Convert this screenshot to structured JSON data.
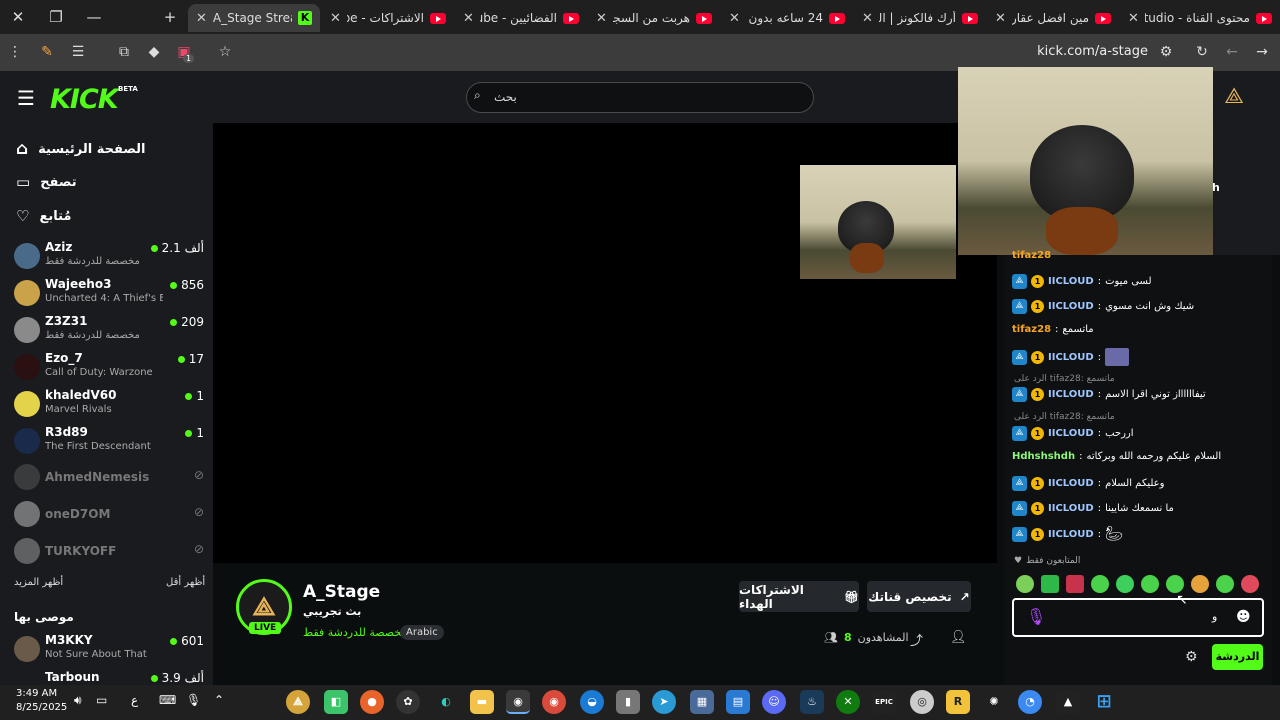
{
  "browser": {
    "tabs": [
      {
        "title": "A_Stage Stream",
        "icon": "kick"
      },
      {
        "title": "الاشتراكات - YouTube",
        "icon": "youtube"
      },
      {
        "title": "الفضائيين - YouTube",
        "icon": "youtube"
      },
      {
        "title": "هربت من السجن",
        "icon": "youtube"
      },
      {
        "title": "24 ساعه بدون جو",
        "icon": "youtube"
      },
      {
        "title": "أرك فالكونز | البدا",
        "icon": "youtube"
      },
      {
        "title": "مين افضل عقاري",
        "icon": "youtube"
      },
      {
        "title": "محتوى القناة - YouTube Studio",
        "icon": "youtube"
      }
    ],
    "new_tab": "+",
    "url": "kick.com/a-stage",
    "extension_badge": "1"
  },
  "header": {
    "logo": "KICK",
    "logo_badge": "BETA",
    "search_placeholder": "بحث"
  },
  "sidebar": {
    "nav": [
      {
        "label": "الصفحة الرئيسية",
        "icon": "home-icon"
      },
      {
        "label": "تصفح",
        "icon": "browse-icon"
      },
      {
        "label": "مُتابع",
        "icon": "heart-icon"
      }
    ],
    "following": [
      {
        "name": "Aziz",
        "sub": "مخصصة للدردشة فقط",
        "count": "2.1 ألف",
        "live": true
      },
      {
        "name": "Wajeeho3",
        "sub": "Uncharted 4: A Thief's End",
        "count": "856",
        "live": true
      },
      {
        "name": "Z3Z31",
        "sub": "مخصصة للدردشة فقط",
        "count": "209",
        "live": true
      },
      {
        "name": "Ezo_7",
        "sub": "Call of Duty: Warzone",
        "count": "17",
        "live": true
      },
      {
        "name": "khaledV60",
        "sub": "Marvel Rivals",
        "count": "1",
        "live": true
      },
      {
        "name": "R3d89",
        "sub": "The First Descendant",
        "count": "1",
        "live": true
      },
      {
        "name": "AhmedNemesis",
        "sub": "",
        "count": "",
        "live": false
      },
      {
        "name": "oneD7OM",
        "sub": "",
        "count": "",
        "live": false
      },
      {
        "name": "TURKYOFF",
        "sub": "",
        "count": "",
        "live": false
      }
    ],
    "show_less": "أظهر أقل",
    "show_more": "أظهر المزيد",
    "recommended_title": "موصى بها",
    "recommended": [
      {
        "name": "M3KKY",
        "sub": "Not Sure About That",
        "count": "601",
        "live": true
      },
      {
        "name": "Tarboun",
        "sub": "",
        "count": "3.9 ألف",
        "live": true
      }
    ]
  },
  "channel": {
    "name": "A_Stage",
    "title": "بث تجريبي",
    "category": "مخصصة للدردشة فقط",
    "language": "Arabic",
    "live_badge": "LIVE",
    "gift_button": "الاشتراكات الهداء",
    "customize_button": "تخصيص قناتك",
    "viewers_label": "المشاهدون",
    "viewers": "8"
  },
  "chat": {
    "partial_title": "h",
    "messages": [
      {
        "user": "tifaz28",
        "text": "",
        "badges": false,
        "color": "orange",
        "partial": true
      },
      {
        "user": "IICLOUD",
        "text": "لسى ميوت",
        "badges": true,
        "color": "blue"
      },
      {
        "user": "IICLOUD",
        "text": "شيك وش انت مسوي",
        "badges": true,
        "color": "blue"
      },
      {
        "user": "tifaz28",
        "text": "ماتسمع",
        "badges": false,
        "color": "orange"
      },
      {
        "user": "IICLOUD",
        "text": "",
        "badges": true,
        "color": "blue",
        "emote": true
      },
      {
        "user": "IICLOUD",
        "text": "تيفااااااز توني اقرا الاسم",
        "badges": true,
        "color": "blue",
        "reply": "الرد على tifaz28: ماتسمع"
      },
      {
        "user": "IICLOUD",
        "text": "اررحب",
        "badges": true,
        "color": "blue",
        "reply": "الرد على tifaz28: ماتسمع"
      },
      {
        "user": "Hdhshshdh",
        "text": "السلام عليكم ورحمه الله وبركاته",
        "badges": false,
        "color": "green"
      },
      {
        "user": "IICLOUD",
        "text": "وعليكم السلام",
        "badges": true,
        "color": "blue"
      },
      {
        "user": "IICLOUD",
        "text": "ما نسمعك شايينا",
        "badges": true,
        "color": "blue"
      },
      {
        "user": "IICLOUD",
        "text": "",
        "badges": true,
        "color": "blue",
        "emote": true
      }
    ],
    "followers_only": "المتابعون فقط",
    "input_text": "و",
    "send_button": "الدردشة"
  },
  "taskbar": {
    "time": "3:49 AM",
    "date": "8/25/2025",
    "lang": "ع"
  }
}
